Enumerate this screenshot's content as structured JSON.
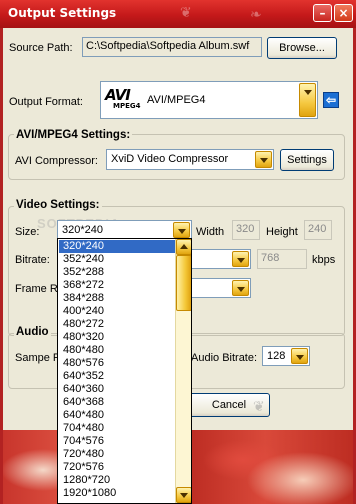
{
  "window": {
    "title": "Output Settings"
  },
  "source": {
    "label": "Source Path:",
    "value": "C:\\Softpedia\\Softpedia Album.swf",
    "browse_label": "Browse..."
  },
  "output_format": {
    "label": "Output Format:",
    "value": "AVI/MPEG4",
    "logo_big": "AVI",
    "logo_small": "MPEG4"
  },
  "avi_settings": {
    "legend": "AVI/MPEG4 Settings:",
    "compressor_label": "AVI Compressor:",
    "compressor_value": "XviD Video Compressor",
    "settings_button": "Settings"
  },
  "video_settings": {
    "legend": "Video Settings:",
    "size_label": "Size:",
    "size_value": "320*240",
    "width_label": "Width",
    "width_value": "320",
    "height_label": "Height",
    "height_value": "240",
    "bitrate_label": "Bitrate:",
    "bitrate_value": "768",
    "bitrate_unit": "kbps",
    "frame_rate_label": "Frame Ra"
  },
  "audio": {
    "legend": "Audio",
    "sample_label": "Sampe R",
    "bitrate_label": "Audio Bitrate:",
    "bitrate_value": "128"
  },
  "cancel_button": "Cancel",
  "watermark": "SOFTPEDIA",
  "size_options": [
    "320*240",
    "352*240",
    "352*288",
    "368*272",
    "384*288",
    "400*240",
    "480*272",
    "480*320",
    "480*480",
    "480*576",
    "640*352",
    "640*360",
    "640*368",
    "640*480",
    "704*480",
    "704*576",
    "720*480",
    "720*576",
    "1280*720",
    "1920*1080"
  ],
  "selected_size_index": 0,
  "colors": {
    "titlebar": "#c4191a",
    "selection": "#316ac5",
    "dialog_bg": "#ece9d8"
  }
}
